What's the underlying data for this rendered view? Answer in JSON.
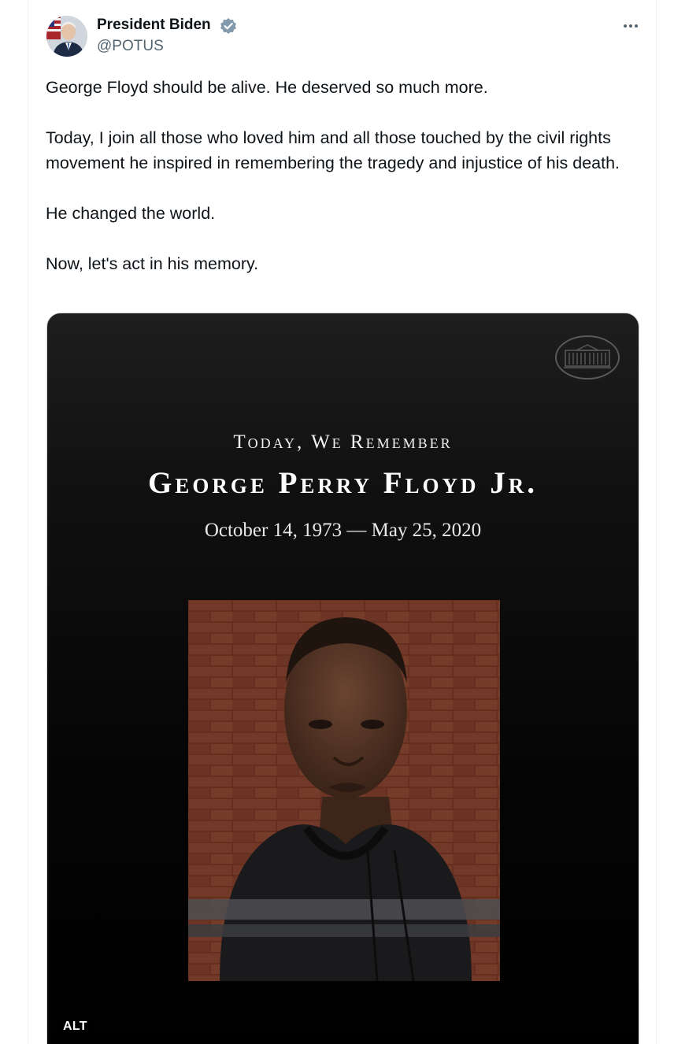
{
  "tweet": {
    "author": {
      "name": "President Biden",
      "handle": "@POTUS",
      "verified": true
    },
    "text": {
      "p1": "George Floyd should be alive. He deserved so much more.",
      "p2": "Today, I join all those who loved him and all those touched by the civil rights movement he inspired in remembering the tragedy and injustice of his death.",
      "p3": "He changed the world.",
      "p4": "Now, let's act in his memory."
    },
    "media": {
      "heading": "Today, We Remember",
      "name": "George Perry Floyd Jr.",
      "dates": "October 14, 1973 — May 25, 2020",
      "alt_label": "ALT"
    }
  },
  "icons": {
    "verified": "verified-badge-icon",
    "more": "more-options-icon",
    "seal": "white-house-seal-icon"
  },
  "colors": {
    "text_primary": "#0f1419",
    "text_secondary": "#536471",
    "verified_badge": "#829aab",
    "media_background": "#000000"
  }
}
